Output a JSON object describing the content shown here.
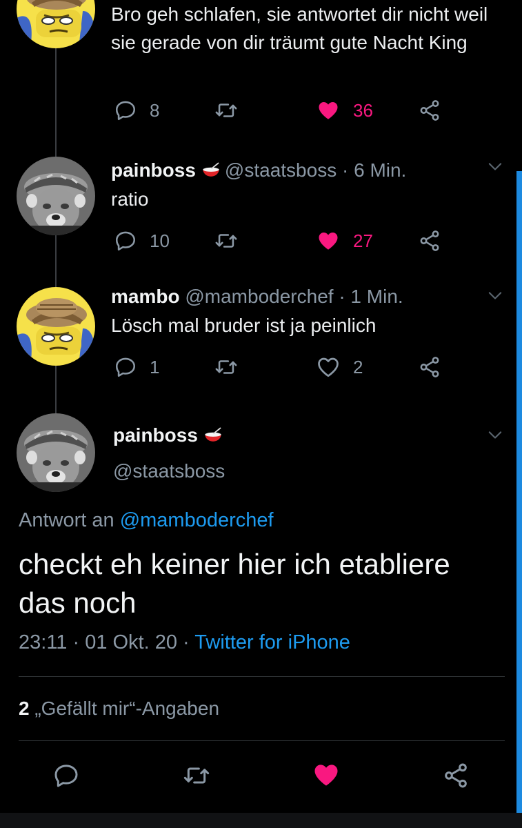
{
  "tweets": [
    {
      "text": "Bro geh schlafen, sie antwortet dir nicht weil sie gerade von dir träumt gute Nacht King",
      "replies": "8",
      "likes": "36",
      "liked": true,
      "avatar": "simpson-avatar"
    },
    {
      "name": "painboss",
      "handle": "@staatsboss",
      "time": "· 6 Min.",
      "text": "ratio",
      "replies": "10",
      "likes": "27",
      "liked": true,
      "avatar": "photo-avatar"
    },
    {
      "name": "mambo",
      "handle": "@mamboderchef",
      "time": "· 1 Min.",
      "text": "Lösch mal bruder ist ja peinlich",
      "replies": "1",
      "likes": "2",
      "liked": false,
      "avatar": "simpson-avatar"
    }
  ],
  "main_tweet": {
    "name": "painboss",
    "handle": "@staatsboss",
    "reply_prefix": "Antwort an",
    "reply_mention": "@mamboderchef",
    "text": "checkt eh keiner hier ich etabliere das noch",
    "timestamp": "23:11 · 01 Okt. 20 ·",
    "source": "Twitter for iPhone",
    "like_count": "2",
    "like_label": "„Gefällt mir“-Angaben",
    "liked": true
  },
  "icons": {
    "reply": "reply-icon",
    "retweet": "retweet-icon",
    "like": "heart-icon",
    "share": "share-icon",
    "more": "chevron-down-icon",
    "emoji": "bowl-emoji"
  },
  "colors": {
    "background": "#000000",
    "accent": "#1d9bf0",
    "like": "#f91880",
    "muted": "#8b98a5"
  }
}
